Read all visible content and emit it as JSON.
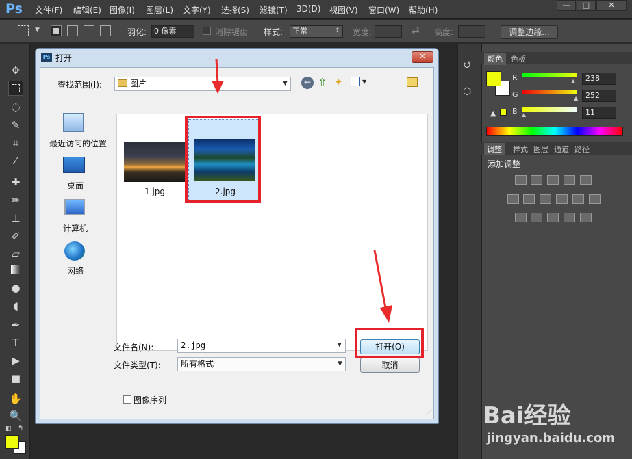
{
  "app": {
    "logo": "Ps",
    "menu": [
      "文件(F)",
      "编辑(E)",
      "图像(I)",
      "图层(L)",
      "文字(Y)",
      "选择(S)",
      "滤镜(T)",
      "3D(D)",
      "视图(V)",
      "窗口(W)",
      "帮助(H)"
    ],
    "window_buttons": [
      "—",
      "□",
      "✕"
    ]
  },
  "options_bar": {
    "feather_label": "羽化:",
    "feather_value": "0 像素",
    "antialias_label": "消除锯齿",
    "style_label": "样式:",
    "style_value": "正常",
    "width_label": "宽度:",
    "height_label": "高度:",
    "refine_edge_button": "调整边缘..."
  },
  "color_panel": {
    "tabs": [
      "颜色",
      "色板"
    ],
    "channels": [
      {
        "label": "R",
        "value": "238"
      },
      {
        "label": "G",
        "value": "252"
      },
      {
        "label": "B",
        "value": "11"
      }
    ],
    "foreground_color": "#eefc0b",
    "background_color": "#ffffff"
  },
  "adjust_panel": {
    "tabs": [
      "调整",
      "样式",
      "图层",
      "通道",
      "路径"
    ],
    "title": "添加调整"
  },
  "dialog": {
    "title": "打开",
    "ps_badge": "Ps",
    "look_in_label": "查找范围(I):",
    "look_in_value": "图片",
    "places": [
      {
        "label": "最近访问的位置",
        "icon": "recent-places-icon"
      },
      {
        "label": "桌面",
        "icon": "desktop-icon"
      },
      {
        "label": "计算机",
        "icon": "computer-icon"
      },
      {
        "label": "网络",
        "icon": "network-icon"
      }
    ],
    "files": [
      {
        "name": "1.jpg",
        "selected": false
      },
      {
        "name": "2.jpg",
        "selected": true
      }
    ],
    "filename_label": "文件名(N):",
    "filename_value": "2.jpg",
    "filetype_label": "文件类型(T):",
    "filetype_value": "所有格式",
    "open_button": "打开(O)",
    "cancel_button": "取消",
    "image_sequence_label": "图像序列"
  },
  "watermark": {
    "brand": "Bai经验",
    "url": "jingyan.baidu.com"
  }
}
